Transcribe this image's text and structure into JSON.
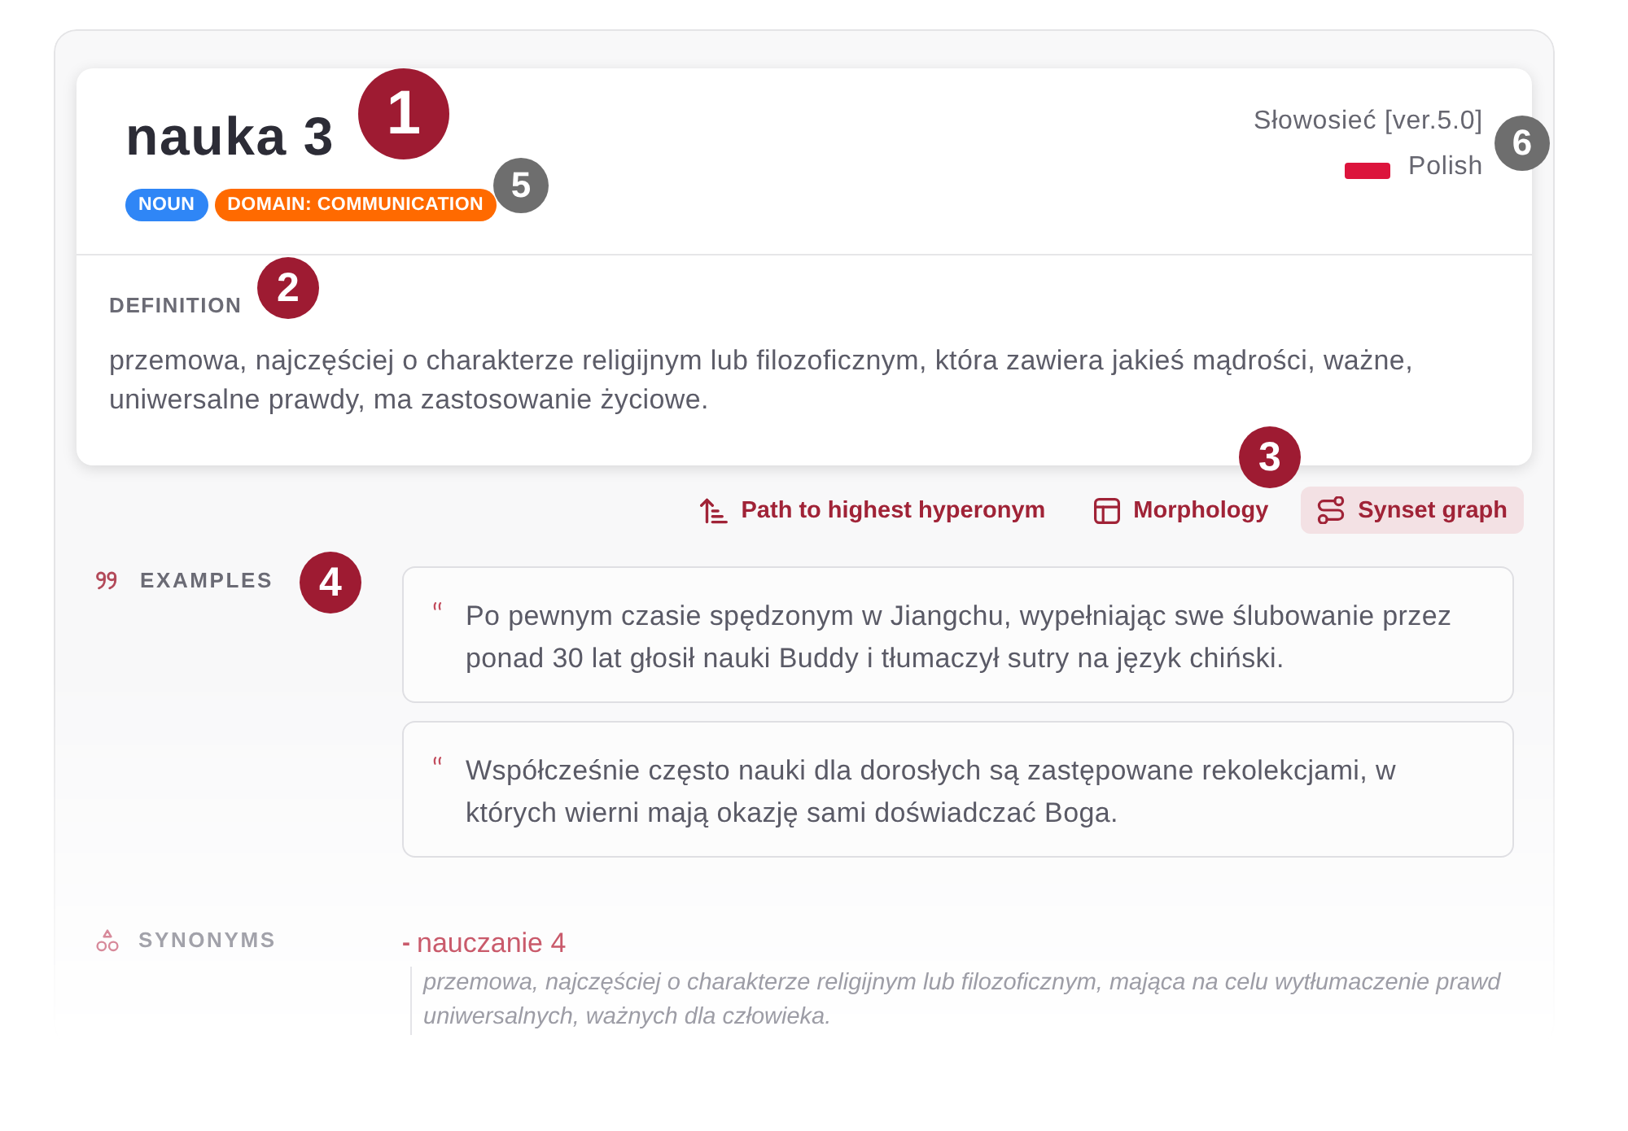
{
  "entry": {
    "title": "nauka 3",
    "tags": [
      {
        "label": "NOUN",
        "color": "#2f86f6"
      },
      {
        "label": "DOMAIN: COMMUNICATION",
        "color": "#ff6a00"
      }
    ],
    "source": "Słowosieć [ver.5.0]",
    "language": "Polish"
  },
  "definition": {
    "label": "DEFINITION",
    "text": "przemowa, najczęściej o charakterze religijnym lub filozoficznym, która zawiera jakieś mądrości, ważne, uniwersalne prawdy, ma zastosowanie życiowe."
  },
  "toolbar": [
    {
      "kind": "path",
      "label": "Path to highest hyperonym",
      "selected": false
    },
    {
      "kind": "table",
      "label": "Morphology",
      "selected": false
    },
    {
      "kind": "graph",
      "label": "Synset graph",
      "selected": true
    }
  ],
  "examples": {
    "label": "EXAMPLES",
    "items": [
      "Po pewnym czasie spędzonym w Jiangchu, wypełniając swe ślubowanie przez ponad 30 lat głosił nauki Buddy i tłumaczył sutry na język chiński.",
      "Współcześnie często nauki dla dorosłych są zastępowane rekolekcjami, w których wierni mają okazję sami doświadczać Boga."
    ]
  },
  "synonyms": {
    "label": "SYNONYMS",
    "items": [
      {
        "bullet": "-",
        "lemma": "nauczanie 4",
        "definition": "przemowa, najczęściej o charakterze religijnym lub filozoficznym, mająca na celu wytłumaczenie prawd uniwersalnych, ważnych dla człowieka."
      }
    ]
  },
  "callouts": [
    {
      "number": "1",
      "color": "#9e1b32"
    },
    {
      "number": "2",
      "color": "#9e1b32"
    },
    {
      "number": "3",
      "color": "#9e1b32"
    },
    {
      "number": "4",
      "color": "#9e1b32"
    },
    {
      "number": "5",
      "color": "#6e6e6e"
    },
    {
      "number": "6",
      "color": "#6e6e6e"
    }
  ]
}
